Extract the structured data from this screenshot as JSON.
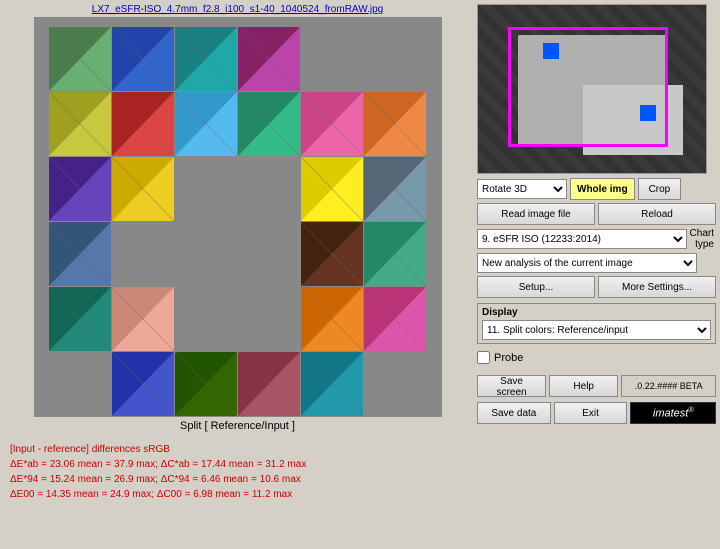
{
  "title": "LX7_eSFR-ISO_4.7mm_f2.8_i100_s1-40_1040524_fromRAW.jpg",
  "chart_label": "Split [ Reference/Input ]",
  "stats": {
    "header": "[Input - reference] differences  sRGB",
    "line1": "ΔE*ab = 23.06 mean = 37.9 max;  ΔC*ab = 17.44 mean = 31.2 max",
    "line2": "ΔE*94 = 15.24 mean = 26.9 max;  ΔC*94 =  6.46 mean = 10.6 max",
    "line3": "ΔE00 = 14.35 mean = 24.9 max;  ΔC00 =  6.98 mean = 11.2 max"
  },
  "controls": {
    "rotate_options": [
      "Rotate 3D"
    ],
    "rotate_selected": "Rotate 3D",
    "whole_img_label": "Whole img",
    "crop_label": "Crop",
    "read_image_label": "Read image file",
    "reload_label": "Reload",
    "chart_type_label": "Chart type",
    "chart_selected": "9. eSFR ISO (12233:2014)",
    "chart_options": [
      "9. eSFR ISO (12233:2014)"
    ],
    "analysis_selected": "New analysis of the current image",
    "analysis_options": [
      "New analysis of the current image"
    ],
    "setup_label": "Setup...",
    "more_settings_label": "More Settings...",
    "display_section_label": "Display",
    "display_selected": "11. Split colors: Reference/input",
    "display_options": [
      "11. Split colors: Reference/input"
    ],
    "probe_label": "Probe",
    "save_screen_label": "Save screen",
    "help_label": "Help",
    "version_label": ".0.22.#### BETA",
    "save_data_label": "Save data",
    "exit_label": "Exit"
  },
  "colors": {
    "accent_blue": "#0055ff",
    "accent_pink": "#ff00ff",
    "title_color": "#0000cc",
    "stats_color": "#cc0000",
    "whole_img_bg": "#ffff88"
  }
}
